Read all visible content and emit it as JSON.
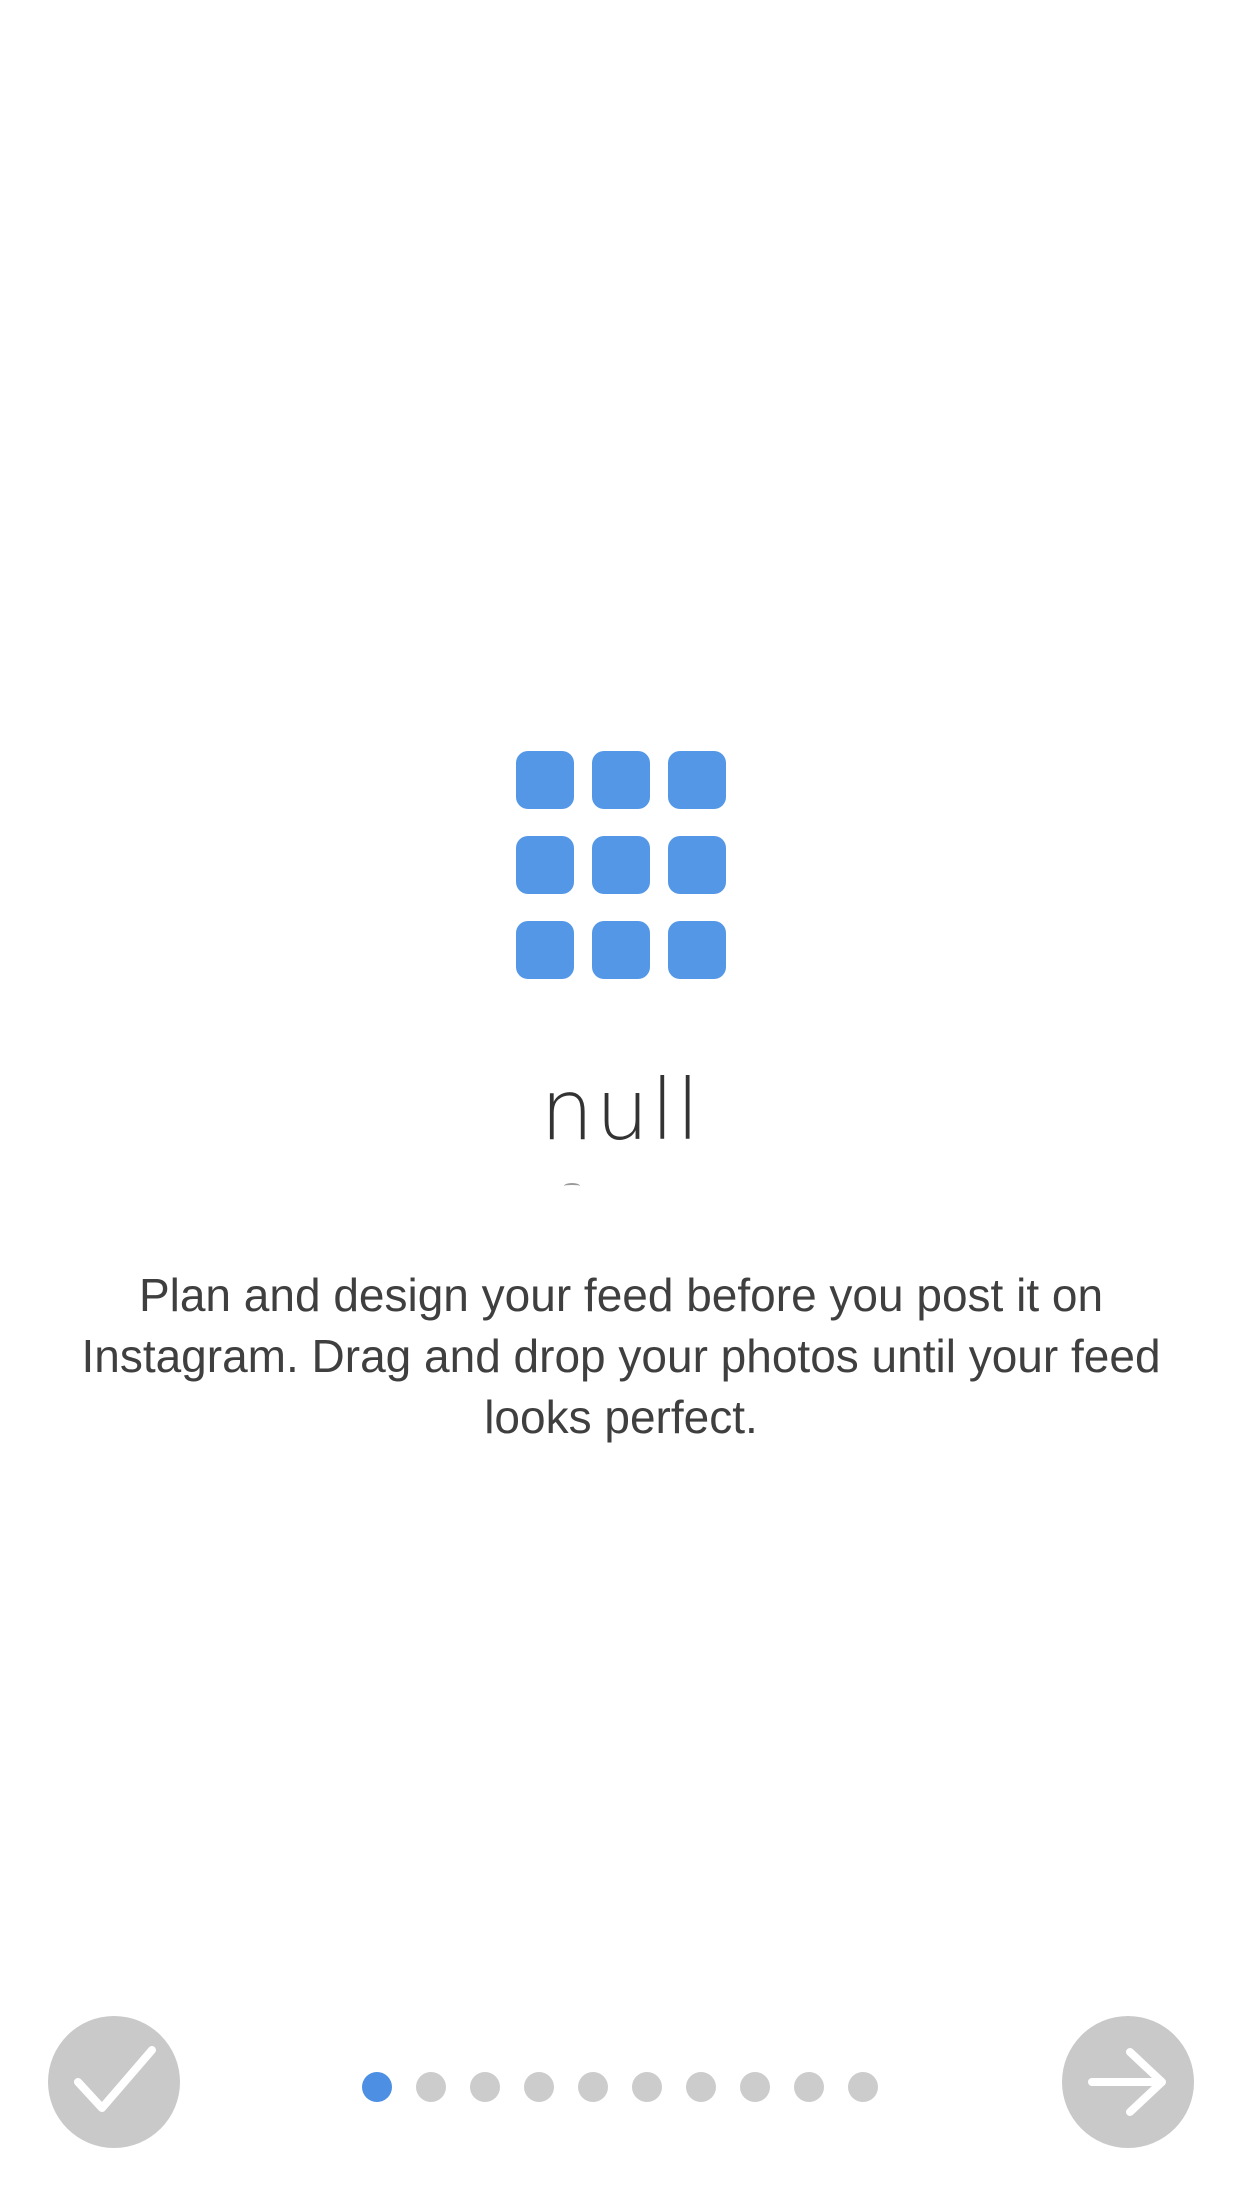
{
  "logo": {
    "icon": "grid-3x3-icon",
    "color": "#5497e6"
  },
  "title": "null",
  "description": "Plan and design your feed before you post it on Instagram. Drag and drop your photos until your feed looks perfect.",
  "footer": {
    "done_icon": "checkmark-icon",
    "next_icon": "arrow-right-icon",
    "button_color": "#c9c9c9"
  },
  "pagination": {
    "total": 10,
    "current": 1,
    "active_color": "#4c8fe3",
    "inactive_color": "#cccccc"
  }
}
